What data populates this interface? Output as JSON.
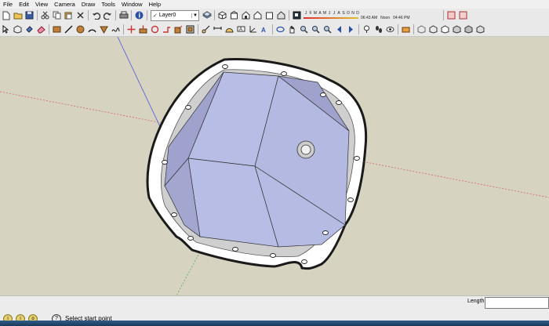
{
  "menu": [
    "File",
    "Edit",
    "View",
    "Camera",
    "Draw",
    "Tools",
    "Window",
    "Help"
  ],
  "layer": {
    "current": "Layer0"
  },
  "shadow": {
    "months": [
      "J",
      "F",
      "M",
      "A",
      "M",
      "J",
      "J",
      "A",
      "S",
      "O",
      "N",
      "D"
    ],
    "time_start": "06:43 AM",
    "noon": "Noon",
    "time_end": "04:46 PM"
  },
  "status": {
    "message": "Select start point",
    "length_label": "Length",
    "length_value": ""
  },
  "colors": {
    "viewport": "#d6d3c0",
    "model_face": "#b8bde6",
    "model_dark": "#9ea2cc",
    "flange": "#ffffff",
    "outline": "#1a1a1a"
  },
  "toolbar1_icons": [
    "new-icon",
    "open-icon",
    "save-icon",
    "cut-icon",
    "copy-icon",
    "paste-icon",
    "erase-icon",
    "undo-icon",
    "redo-icon",
    "print-icon",
    "model-info-icon",
    "layer-icon",
    "iso-icon",
    "top-icon",
    "front-icon",
    "right-icon",
    "back-icon",
    "left-icon",
    "shadow-icon",
    "fog-icon"
  ],
  "toolbar2_icons": [
    "select-icon",
    "component-icon",
    "paint-icon",
    "eraser-icon",
    "rectangle-icon",
    "line-icon",
    "circle-icon",
    "arc-icon",
    "polygon-icon",
    "freehand-icon",
    "move-icon",
    "pushpull-icon",
    "rotate-icon",
    "followme-icon",
    "scale-icon",
    "offset-icon",
    "tape-icon",
    "dimension-icon",
    "protractor-icon",
    "text-icon",
    "axes-icon",
    "3dtext-icon",
    "orbit-icon",
    "pan-icon",
    "zoom-icon",
    "zoom-window-icon",
    "zoom-extents-icon",
    "previous-icon",
    "next-icon",
    "position-camera-icon",
    "walk-icon",
    "look-around-icon",
    "section-icon",
    "xray-icon",
    "wireframe-icon",
    "hidden-line-icon",
    "shaded-icon",
    "shaded-texture-icon",
    "monochrome-icon"
  ]
}
